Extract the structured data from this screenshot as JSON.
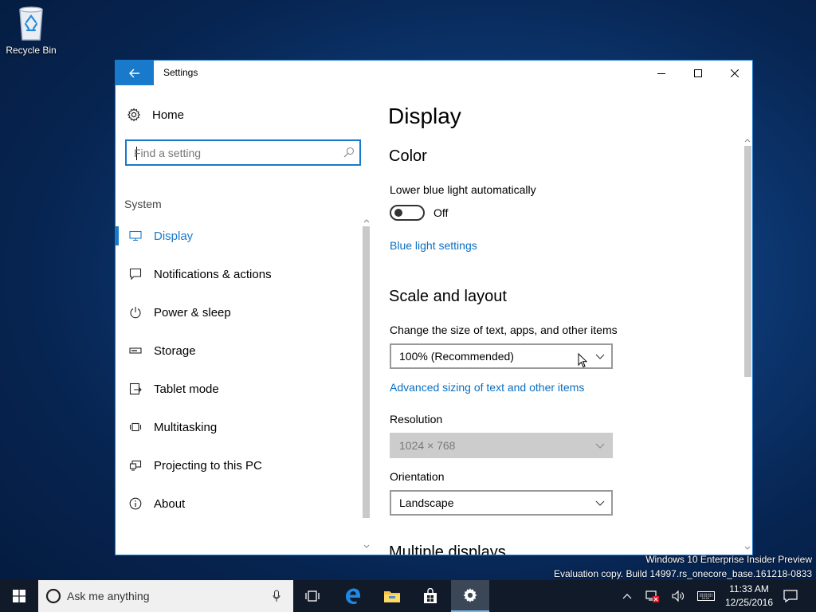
{
  "desktop": {
    "recycle_bin_label": "Recycle Bin",
    "watermark_line1": "Windows 10 Enterprise Insider Preview",
    "watermark_line2": "Evaluation copy. Build 14997.rs_onecore_base.161218-0833"
  },
  "window": {
    "title": "Settings",
    "accent_color": "#1979ca"
  },
  "nav": {
    "home_label": "Home",
    "search_placeholder": "Find a setting",
    "section_label": "System",
    "items": [
      {
        "label": "Display",
        "icon": "monitor-icon",
        "active": true
      },
      {
        "label": "Notifications & actions",
        "icon": "notification-icon",
        "active": false
      },
      {
        "label": "Power & sleep",
        "icon": "power-icon",
        "active": false
      },
      {
        "label": "Storage",
        "icon": "storage-icon",
        "active": false
      },
      {
        "label": "Tablet mode",
        "icon": "tablet-icon",
        "active": false
      },
      {
        "label": "Multitasking",
        "icon": "multitasking-icon",
        "active": false
      },
      {
        "label": "Projecting to this PC",
        "icon": "projecting-icon",
        "active": false
      },
      {
        "label": "About",
        "icon": "info-icon",
        "active": false
      }
    ]
  },
  "content": {
    "page_title": "Display",
    "color_heading": "Color",
    "blue_light_label": "Lower blue light automatically",
    "blue_light_state": "Off",
    "blue_light_link": "Blue light settings",
    "scale_heading": "Scale and layout",
    "scale_label": "Change the size of text, apps, and other items",
    "scale_value": "100% (Recommended)",
    "advanced_link": "Advanced sizing of text and other items",
    "resolution_label": "Resolution",
    "resolution_value": "1024 × 768",
    "orientation_label": "Orientation",
    "orientation_value": "Landscape",
    "multiple_heading": "Multiple displays"
  },
  "taskbar": {
    "search_placeholder": "Ask me anything",
    "clock_time": "11:33 AM",
    "clock_date": "12/25/2016"
  }
}
